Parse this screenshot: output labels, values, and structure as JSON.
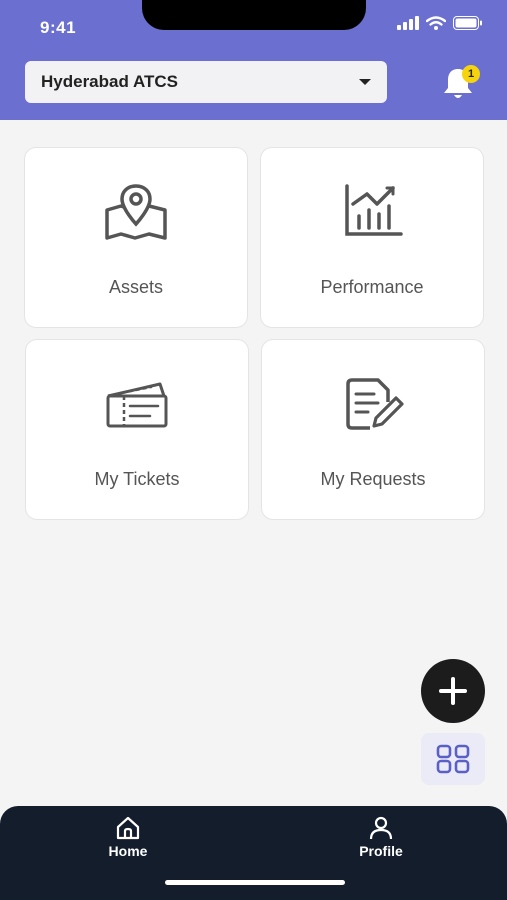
{
  "status_bar": {
    "time": "9:41"
  },
  "header": {
    "location_select": {
      "value": "Hyderabad ATCS"
    },
    "notifications": {
      "count": "1"
    }
  },
  "tiles": [
    {
      "label": "Assets",
      "icon": "map-pin-icon"
    },
    {
      "label": "Performance",
      "icon": "chart-icon"
    },
    {
      "label": "My Tickets",
      "icon": "ticket-icon"
    },
    {
      "label": "My Requests",
      "icon": "document-edit-icon"
    }
  ],
  "fab": {
    "add_icon": "plus-icon",
    "menu_icon": "grid-icon"
  },
  "bottom_nav": {
    "items": [
      {
        "label": "Home",
        "icon": "home-icon"
      },
      {
        "label": "Profile",
        "icon": "person-icon"
      }
    ]
  },
  "colors": {
    "header": "#6a6fd0",
    "nav": "#141d2c",
    "badge": "#f6d40d",
    "grid_icon": "#5b60c6"
  }
}
